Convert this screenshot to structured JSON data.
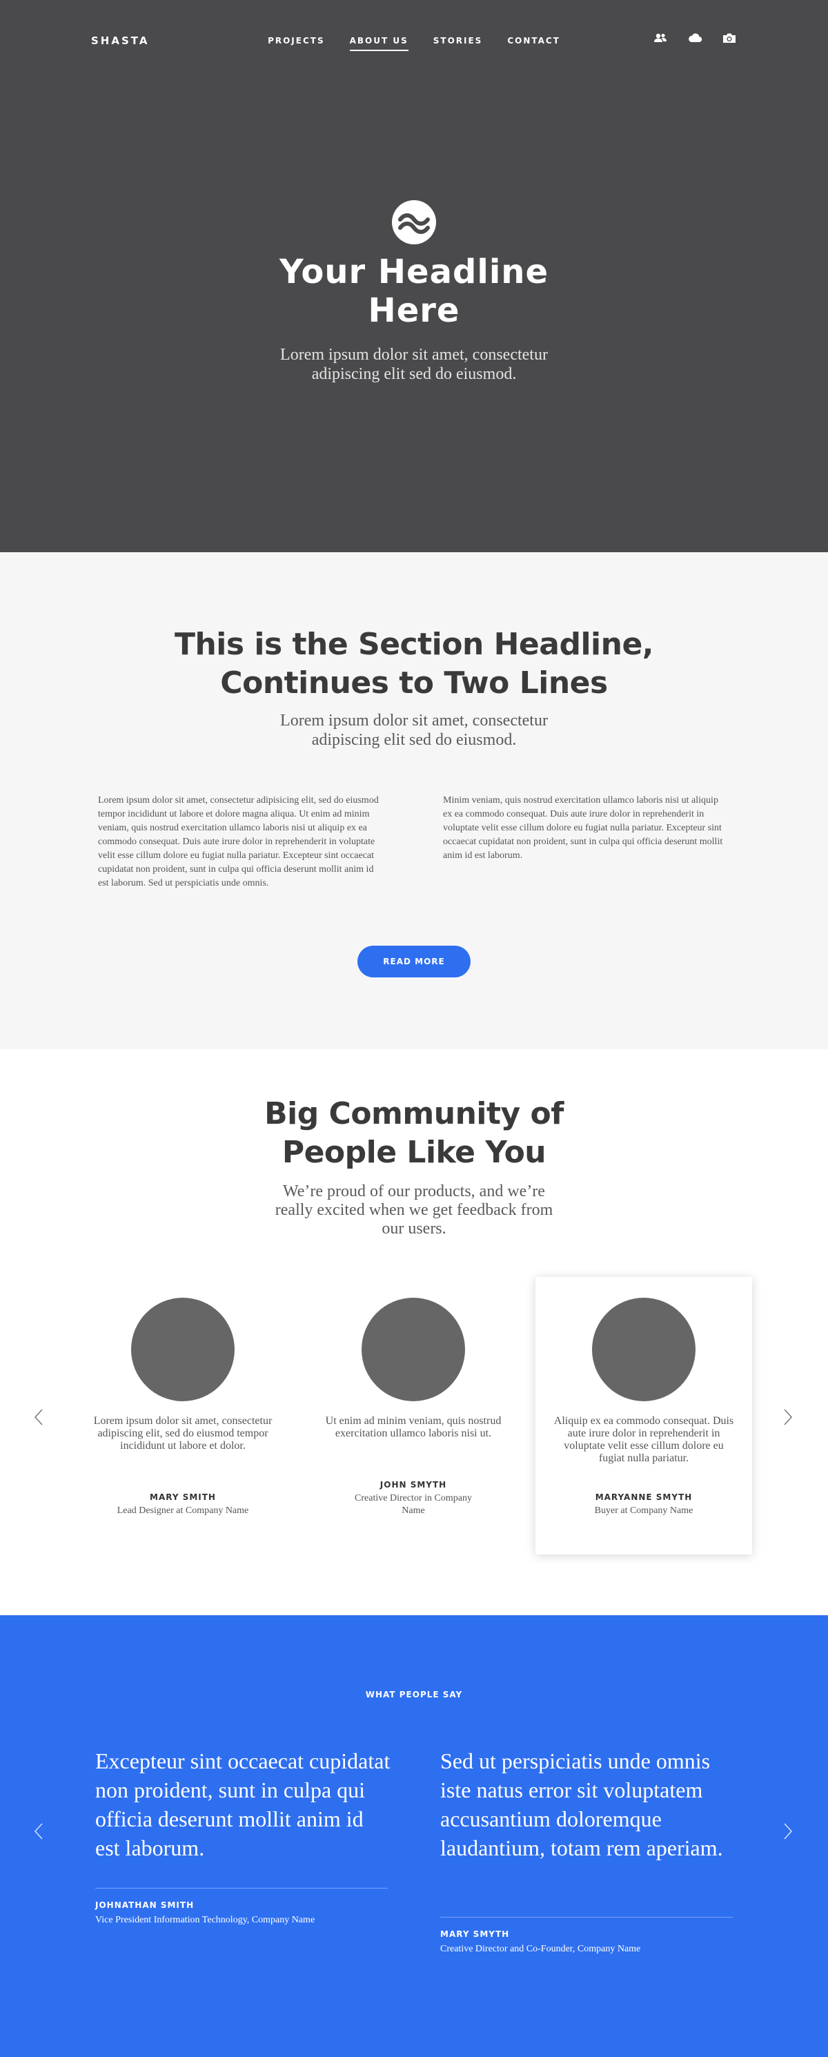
{
  "header": {
    "brand": "SHASTA",
    "nav": [
      {
        "label": "PROJECTS",
        "active": false
      },
      {
        "label": "ABOUT US",
        "active": true
      },
      {
        "label": "STORIES",
        "active": false
      },
      {
        "label": "CONTACT",
        "active": false
      }
    ],
    "icons": [
      "people-icon",
      "cloud-icon",
      "camera-icon"
    ]
  },
  "hero": {
    "logo_icon": "wave-circle-icon",
    "title_line1": "Your Headline",
    "title_line2": "Here",
    "subtitle": "Lorem ipsum dolor sit amet, consectetur adipiscing elit sed do eiusmod."
  },
  "section": {
    "title_line1": "This is the Section Headline,",
    "title_line2": "Continues to Two Lines",
    "subtitle": "Lorem ipsum dolor sit amet, consectetur adipiscing elit sed do eiusmod.",
    "col_left": "Lorem ipsum dolor sit amet, consectetur adipisicing elit, sed do eiusmod tempor incididunt ut labore et dolore magna aliqua. Ut enim ad minim veniam, quis nostrud exercitation ullamco laboris nisi ut aliquip ex ea commodo consequat. Duis aute irure dolor in reprehenderit in voluptate velit esse cillum dolore eu fugiat nulla pariatur. Excepteur sint occaecat cupidatat non proident, sunt in culpa qui officia deserunt mollit anim id est laborum. Sed ut perspiciatis unde omnis.",
    "col_right": "Minim veniam, quis nostrud exercitation ullamco laboris nisi ut aliquip ex ea commodo consequat. Duis aute irure dolor in reprehenderit in voluptate velit esse cillum dolore eu fugiat nulla pariatur. Excepteur sint occaecat cupidatat non proident, sunt in culpa qui officia deserunt mollit anim id est laborum.",
    "button_label": "READ MORE"
  },
  "community": {
    "title_line1": "Big Community of",
    "title_line2": "People Like You",
    "subtitle": "We’re proud of our products, and we’re really excited when we get feedback from our users.",
    "cards": [
      {
        "quote": "Lorem ipsum dolor sit amet, consectetur adipiscing elit, sed do eiusmod tempor incididunt ut labore et dolor.",
        "name": "MARY SMITH",
        "role": "Lead Designer at Company Name",
        "featured": false
      },
      {
        "quote": "Ut enim ad minim veniam, quis nostrud exercitation ullamco laboris nisi ut.",
        "name": "JOHN SMYTH",
        "role": "Creative Director in Company Name",
        "featured": false
      },
      {
        "quote": "Aliquip ex ea commodo consequat. Duis aute irure dolor in reprehenderit in voluptate velit esse cillum dolore eu fugiat nulla pariatur.",
        "name": "MARYANNE SMYTH",
        "role": "Buyer at Company Name",
        "featured": true
      }
    ]
  },
  "testimonials": {
    "label": "WHAT PEOPLE SAY",
    "items": [
      {
        "quote": "Excepteur sint occaecat cupidatat non proident, sunt in culpa qui officia deserunt mollit anim id est laborum.",
        "name": "JOHNATHAN SMITH",
        "role": "Vice President Information Technology, Company Name"
      },
      {
        "quote": "Sed ut perspiciatis unde omnis iste natus error sit voluptatem accusantium doloremque laudantium, totam rem aperiam.",
        "name": "MARY SMYTH",
        "role": "Creative Director and Co-Founder, Company Name"
      }
    ]
  },
  "colors": {
    "hero_bg": "#4a4a4c",
    "section_bg": "#f6f6f6",
    "accent": "#2e6ff0",
    "avatar_placeholder": "#666666"
  }
}
